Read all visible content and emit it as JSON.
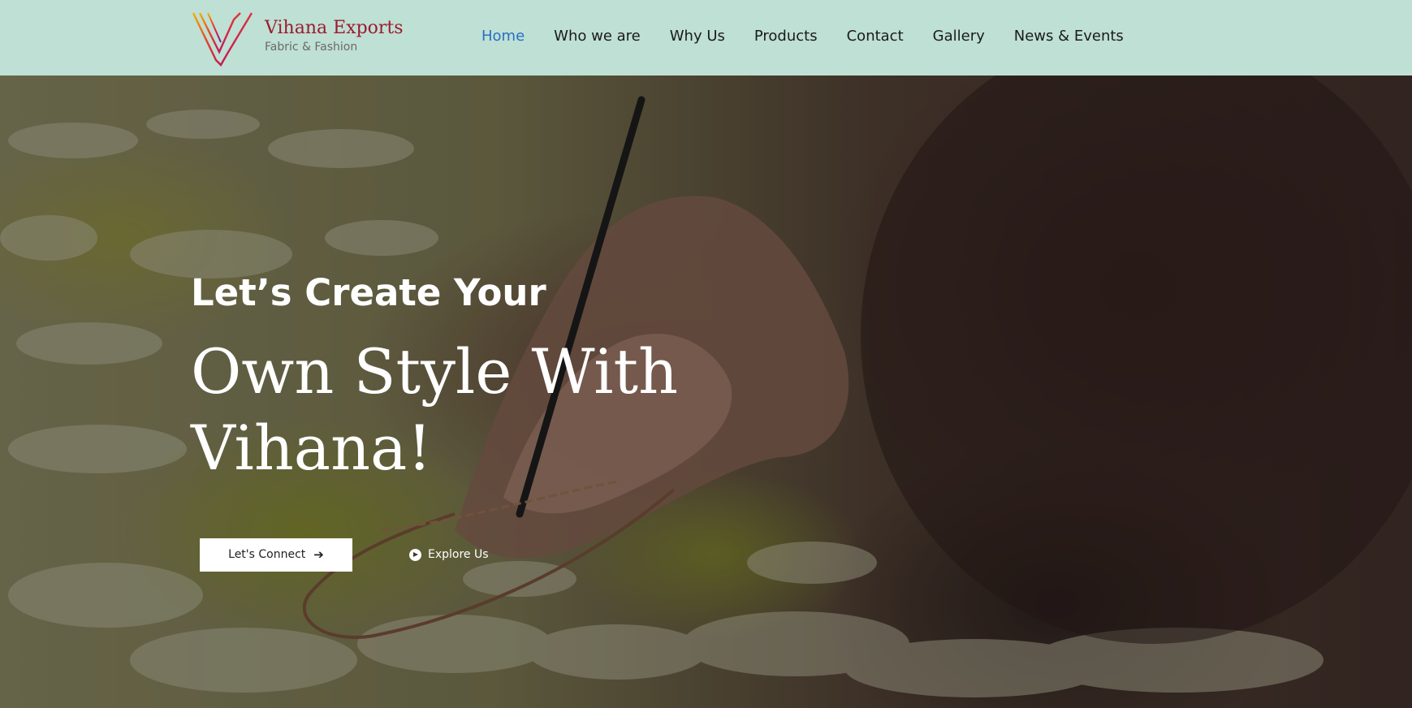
{
  "brand": {
    "name": "Vihana Exports",
    "tagline": "Fabric & Fashion"
  },
  "nav": {
    "items": [
      {
        "label": "Home",
        "active": true
      },
      {
        "label": "Who we are"
      },
      {
        "label": "Why Us"
      },
      {
        "label": "Products"
      },
      {
        "label": "Contact"
      },
      {
        "label": "Gallery"
      },
      {
        "label": "News & Events"
      }
    ]
  },
  "hero": {
    "subtitle": "Let’s Create Your",
    "title_line1": "Own Style With",
    "title_line2": "Vihana!",
    "connect_label": "Let's Connect",
    "explore_label": "Explore Us"
  },
  "colors": {
    "header_bg": "#bfe0d4",
    "brand_red": "#9b1b30",
    "nav_active": "#2a6fc3"
  },
  "icons": {
    "logo": "v-logo-icon",
    "arrow": "arrow-right-icon",
    "play": "play-circle-icon"
  }
}
